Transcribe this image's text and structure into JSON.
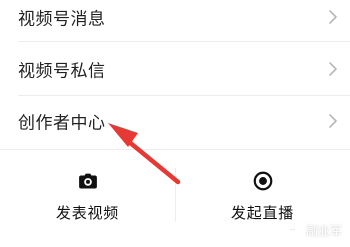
{
  "menu": {
    "items": [
      {
        "label": "视频号消息"
      },
      {
        "label": "视频号私信"
      },
      {
        "label": "创作者中心"
      }
    ]
  },
  "actions": {
    "publish": {
      "label": "发表视频",
      "icon": "camera-icon"
    },
    "live": {
      "label": "发起直播",
      "icon": "live-record-icon"
    }
  },
  "annotation": {
    "arrow_color": "#e53935"
  },
  "watermark": {
    "text": "副业军"
  }
}
